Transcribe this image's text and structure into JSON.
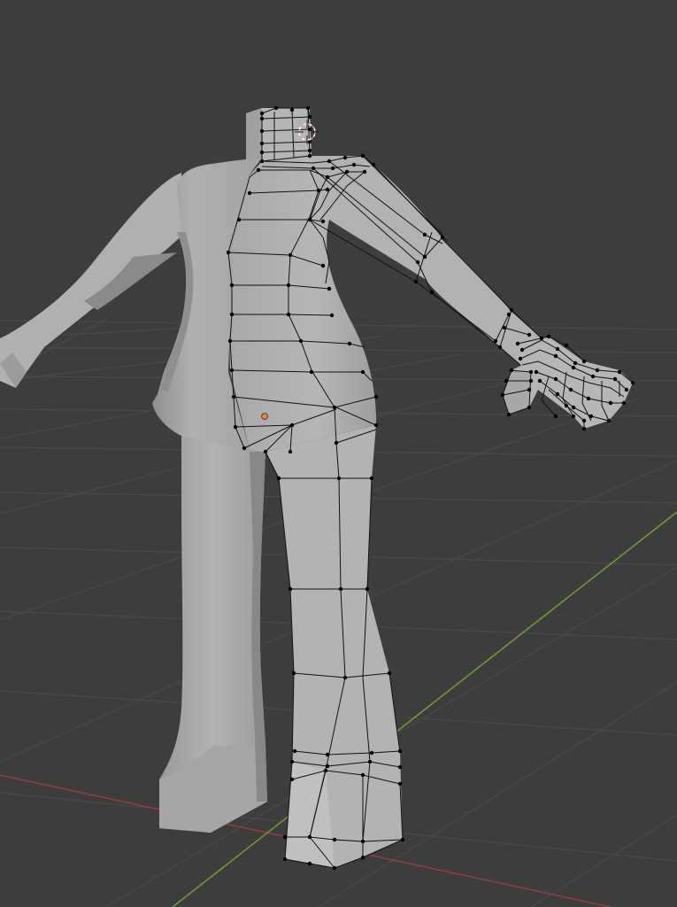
{
  "viewport": {
    "background_color": "#3d3d3d",
    "grid_color": "#484848",
    "x_axis_color": "#9a3a42",
    "y_axis_color": "#6f9a2a",
    "mesh_color": "#a9a9a9",
    "mesh_shadow_color": "#6e6e6e",
    "wire_color": "#000000",
    "origin_color": "#f08a1c",
    "cursor_color": "#e6a3b0"
  },
  "scene": {
    "object": "human-body-mesh",
    "mode": "edit-mode",
    "modifier": "mirror",
    "icons": {
      "cursor": "3d-cursor-icon",
      "origin": "object-origin-icon"
    }
  }
}
